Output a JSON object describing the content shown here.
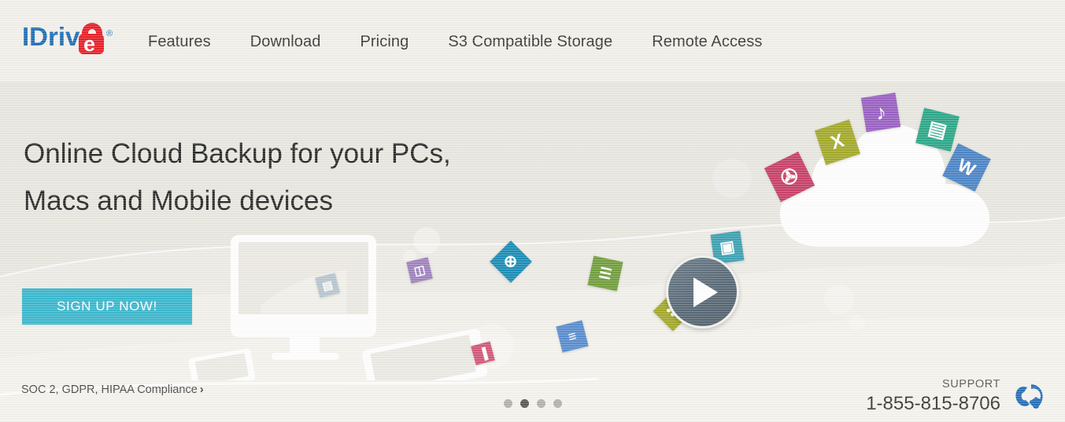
{
  "site": {
    "brand_name": "IDrive",
    "brand_mark": "®",
    "logo_text_primary": "IDriv",
    "logo_text_accent": "e"
  },
  "colors": {
    "page_background": "#e9e8e1",
    "header_background": "#f2f1ec",
    "cta_background": "#3cb9cf",
    "logo_blue": "#1f6fb5",
    "logo_red": "#e8232a",
    "play_button": "#5b6b78",
    "phone_icon": "#2a72b8",
    "headline_text": "#2b2b2b",
    "active_dot": "#5a5a56",
    "inactive_dot": "#b4b4ae"
  },
  "header": {
    "nav": [
      {
        "label": "Features",
        "name": "nav-features"
      },
      {
        "label": "Download",
        "name": "nav-download"
      },
      {
        "label": "Pricing",
        "name": "nav-pricing"
      },
      {
        "label": "S3 Compatible Storage",
        "name": "nav-s3-compatible-storage"
      },
      {
        "label": "Remote Access",
        "name": "nav-remote-access"
      }
    ]
  },
  "hero": {
    "headline_line1": "Online Cloud Backup for your PCs,",
    "headline_line2": "Macs and Mobile devices",
    "cta_label": "SIGN UP NOW!",
    "compliance_text": "SOC 2, GDPR, HIPAA Compliance",
    "compliance_chevron": "›",
    "play_button_label": "Play video",
    "carousel": {
      "total_slides": 4,
      "active_index": 1
    },
    "illustration": {
      "cloud": "cloud-shape",
      "devices": [
        "desktop-monitor",
        "smartphone",
        "tablet"
      ],
      "file_tiles": [
        {
          "name": "file-tile-pdf",
          "glyph": "✇",
          "color": "#c8436b",
          "label": "PDF"
        },
        {
          "name": "file-tile-excel",
          "glyph": "X",
          "color": "#a5ab2c",
          "label": "Excel"
        },
        {
          "name": "file-tile-music",
          "glyph": "♪",
          "color": "#9b63c4",
          "label": "Audio"
        },
        {
          "name": "file-tile-video",
          "glyph": "▤",
          "color": "#2fa98a",
          "label": "Video"
        },
        {
          "name": "file-tile-word",
          "glyph": "W",
          "color": "#4e87c7",
          "label": "Word"
        },
        {
          "name": "file-tile-image",
          "glyph": "▣",
          "color": "#3fa3b3",
          "label": "Image"
        },
        {
          "name": "file-tile-globe",
          "glyph": "⊕",
          "color": "#1d8fb8",
          "label": "Web"
        },
        {
          "name": "file-tile-doc-green",
          "glyph": "☰",
          "color": "#74a03f",
          "label": "Document"
        },
        {
          "name": "file-tile-archive",
          "glyph": "✣",
          "color": "#a5ab2c",
          "label": "Archive"
        },
        {
          "name": "file-tile-text-blue",
          "glyph": "≡",
          "color": "#5b8fd1",
          "label": "Text"
        },
        {
          "name": "file-tile-note-purple",
          "glyph": "◫",
          "color": "#a184c0",
          "label": "Note"
        },
        {
          "name": "file-tile-chart-pink",
          "glyph": "▐",
          "color": "#d35a79",
          "label": "Chart"
        },
        {
          "name": "file-tile-screen-grey",
          "glyph": "▤",
          "color": "#9fb4c4",
          "label": "Screen"
        }
      ]
    }
  },
  "support": {
    "label": "SUPPORT",
    "phone": "1-855-815-8706",
    "icon": "phone-icon"
  }
}
